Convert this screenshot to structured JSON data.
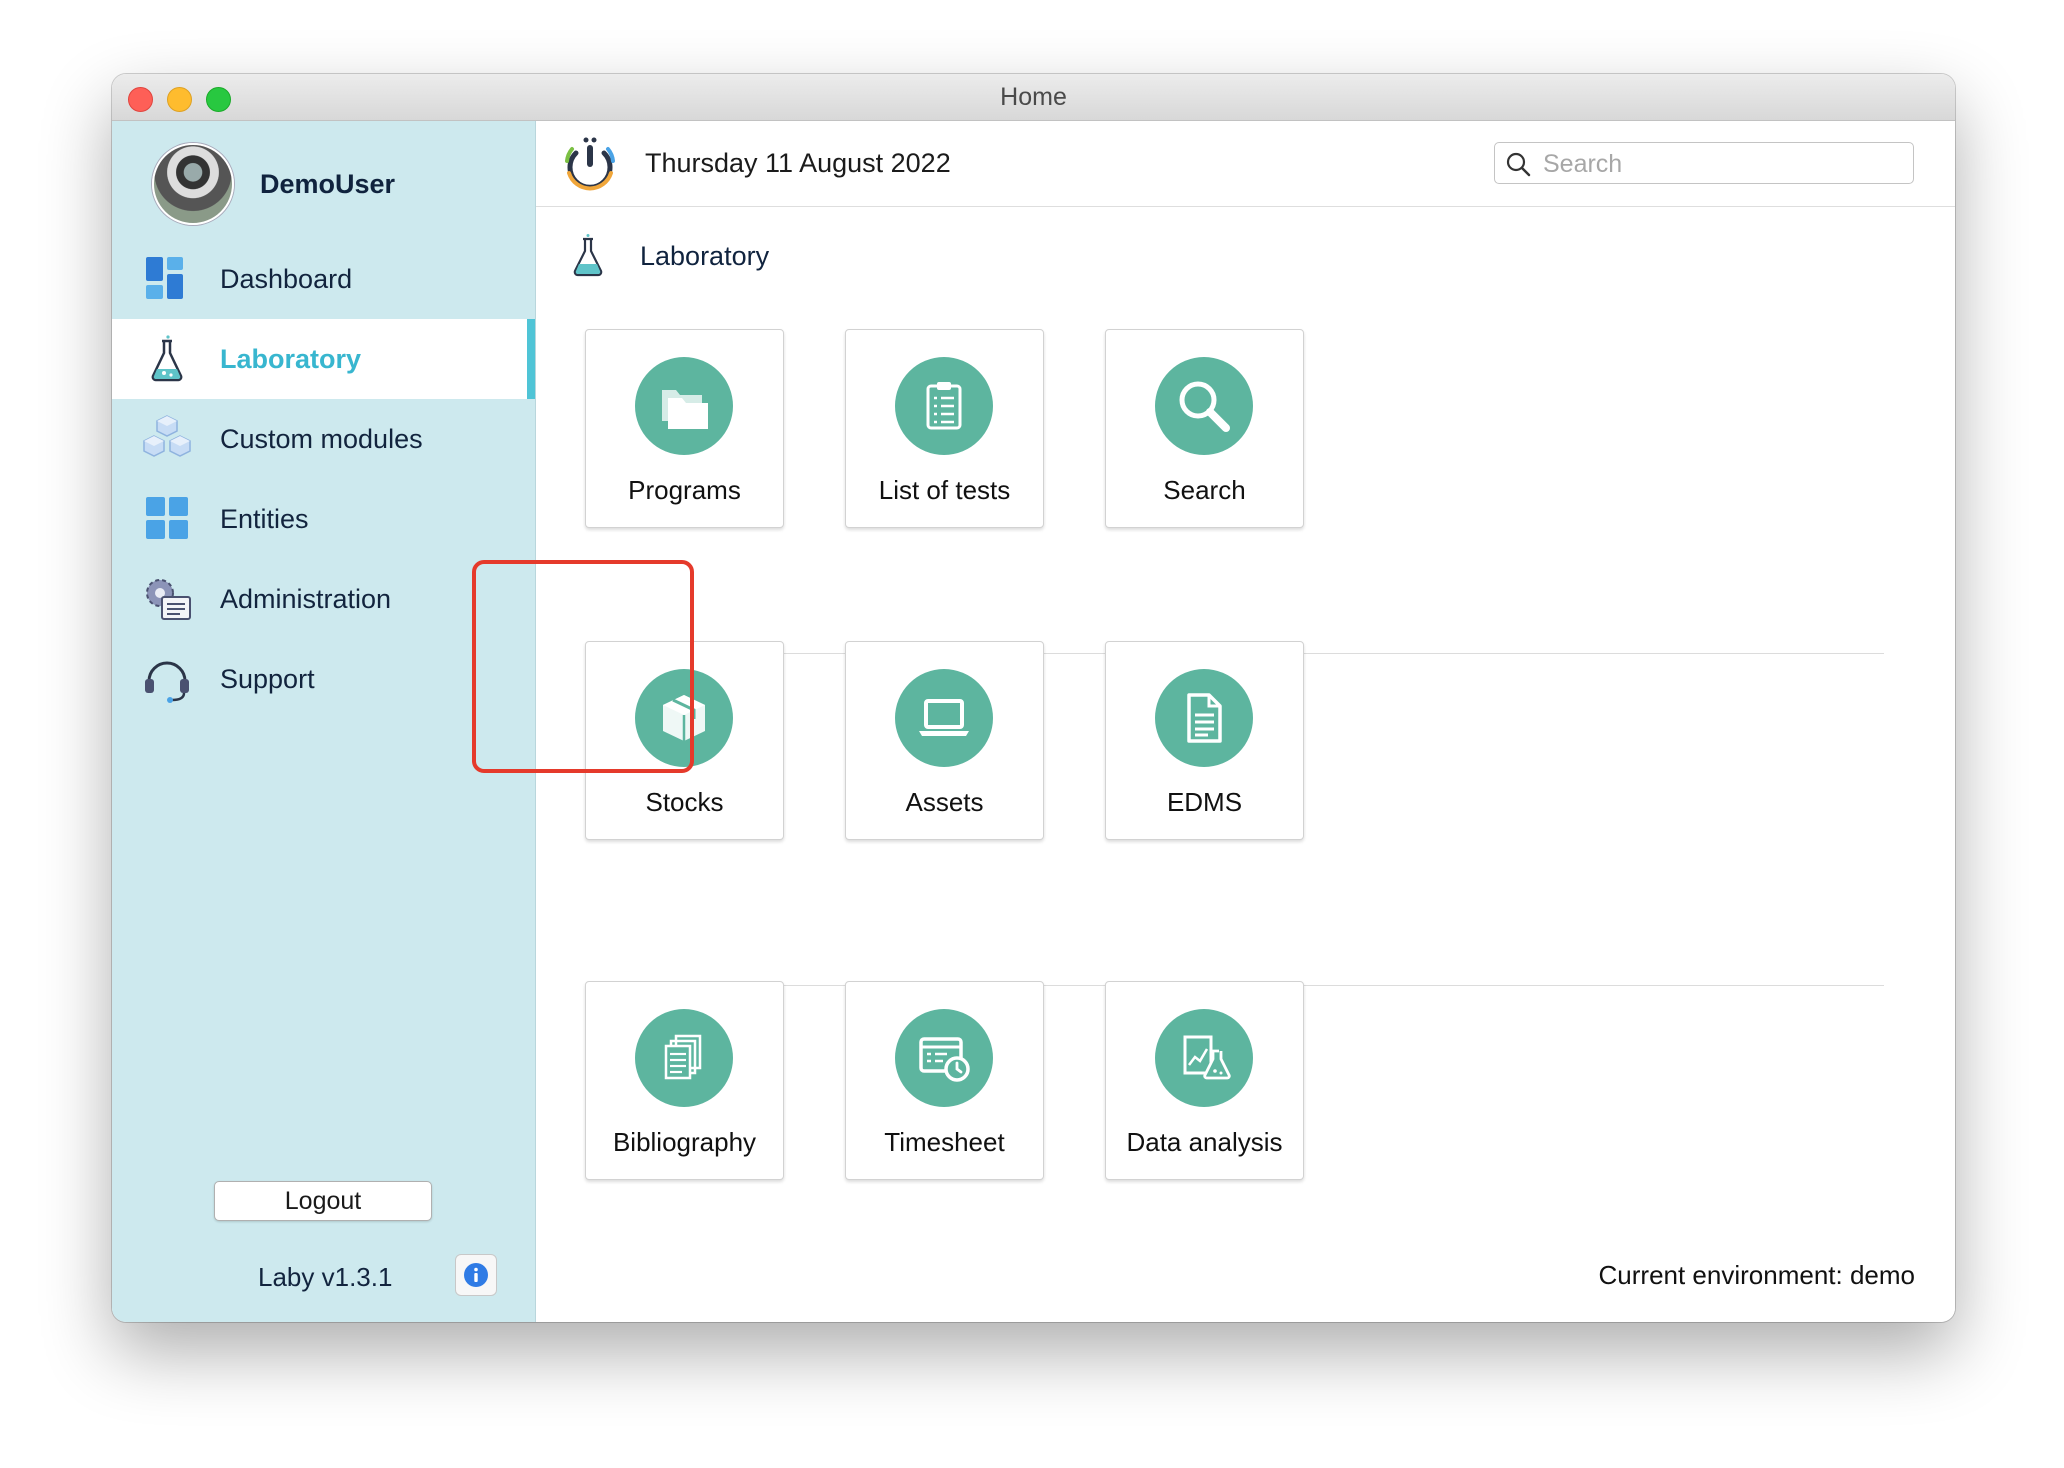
{
  "window": {
    "title": "Home"
  },
  "user": {
    "name": "DemoUser"
  },
  "sidebar": {
    "items": [
      {
        "label": "Dashboard",
        "icon": "dashboard-icon",
        "active": false
      },
      {
        "label": "Laboratory",
        "icon": "flask-icon",
        "active": true
      },
      {
        "label": "Custom modules",
        "icon": "cubes-icon",
        "active": false
      },
      {
        "label": "Entities",
        "icon": "grid-icon",
        "active": false
      },
      {
        "label": "Administration",
        "icon": "gear-settings-icon",
        "active": false
      },
      {
        "label": "Support",
        "icon": "headset-icon",
        "active": false
      }
    ],
    "logout_label": "Logout",
    "version": "Laby v1.3.1"
  },
  "header": {
    "date": "Thursday 11 August 2022",
    "search_placeholder": "Search"
  },
  "section": {
    "title": "Laboratory"
  },
  "tiles": [
    {
      "label": "Programs",
      "icon": "folders-icon"
    },
    {
      "label": "List of tests",
      "icon": "clipboard-checklist-icon"
    },
    {
      "label": "Search",
      "icon": "magnifier-icon"
    },
    {
      "label": "Stocks",
      "icon": "box-icon",
      "highlighted": true
    },
    {
      "label": "Assets",
      "icon": "laptop-icon"
    },
    {
      "label": "EDMS",
      "icon": "document-icon"
    },
    {
      "label": "Bibliography",
      "icon": "stacked-documents-icon"
    },
    {
      "label": "Timesheet",
      "icon": "calendar-clock-icon"
    },
    {
      "label": "Data analysis",
      "icon": "chart-flask-icon"
    }
  ],
  "footer": {
    "environment": "Current environment: demo"
  },
  "colors": {
    "sidebar_bg": "#cde9ee",
    "accent": "#38b6cf",
    "tile_icon": "#5db59f",
    "highlight": "#e53a2b"
  }
}
